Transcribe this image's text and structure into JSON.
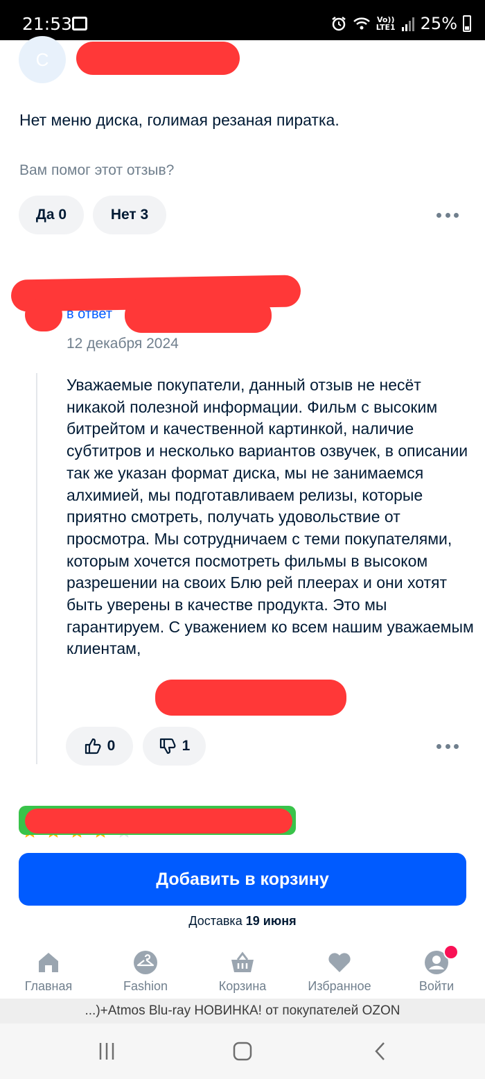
{
  "status_bar": {
    "time": "21:53",
    "network_top": "Vo))",
    "network_bottom": "LTE1",
    "battery": "25%"
  },
  "review": {
    "avatar_letter": "С",
    "text": "Нет меню диска, голимая резаная пиратка.",
    "helpful_question": "Вам помог этот отзыв?",
    "yes_label": "Да 0",
    "no_label": "Нет 3"
  },
  "reply": {
    "reply_to": "в ответ",
    "date": "12 декабря 2024",
    "text": "Уважаемые покупатели, данный отзыв не несёт никакой полезной информации. Фильм с высоким битрейтом и качественной картинкой, наличие субтитров и несколько вариантов озвучек, в описании так же указан формат диска, мы не занимаемся алхимией, мы подготавливаем релизы, которые приятно смотреть, получать удовольствие от просмотра. Мы сотрудничаем с теми покупателями, которым хочется посмотреть фильмы в высоком разрешении на своих Блю рей плеерах и они хотят быть уверены в качестве продукта. Это мы гарантируем. С уважением ко всем нашим уважаемым клиентам,",
    "likes": "0",
    "dislikes": "1"
  },
  "next_review": {
    "rating": 4,
    "max_rating": 5
  },
  "cart": {
    "button_label": "Добавить в корзину",
    "delivery_prefix": "Доставка",
    "delivery_date": "19 июня"
  },
  "nav": {
    "home": "Главная",
    "fashion": "Fashion",
    "cart": "Корзина",
    "favorites": "Избранное",
    "login": "Войти"
  },
  "url_bar": "...)+Atmos Blu-ray НОВИНКА! от покупателей OZON",
  "colors": {
    "accent": "#005bff",
    "text": "#001a34",
    "muted": "#707f8d",
    "redaction": "#ff3838",
    "star": "#ffb800"
  }
}
